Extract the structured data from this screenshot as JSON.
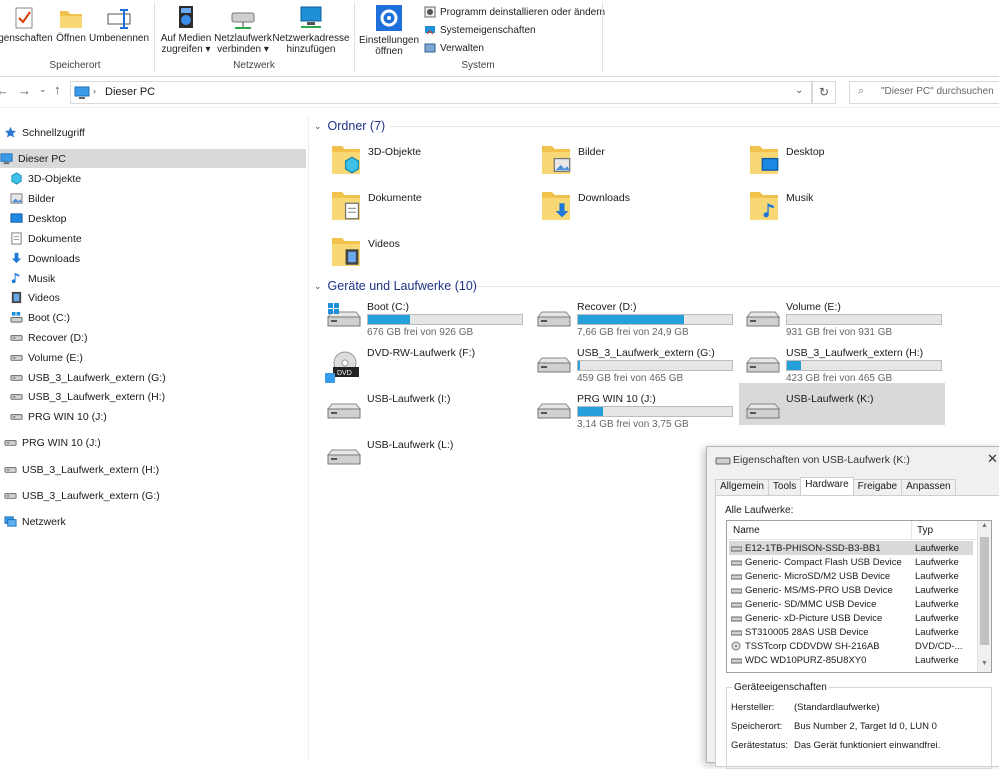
{
  "ribbon": {
    "buttons": [
      {
        "label": "igenschaften"
      },
      {
        "label": "Öffnen"
      },
      {
        "label": "Umbenennen"
      },
      {
        "label1": "Auf Medien",
        "label2": "zugreifen ▾"
      },
      {
        "label1": "Netzlaufwerk",
        "label2": "verbinden ▾"
      },
      {
        "label1": "Netzwerkadresse",
        "label2": "hinzufügen"
      },
      {
        "label1": "Einstellungen",
        "label2": "öffnen"
      }
    ],
    "small_items": [
      "Programm deinstallieren oder ändern",
      "Systemeigenschaften",
      "Verwalten"
    ],
    "groups": [
      "Speicherort",
      "Netzwerk",
      "System"
    ]
  },
  "nav": {
    "path": "Dieser PC",
    "search_placeholder": "\"Dieser PC\" durchsuchen"
  },
  "sidebar": {
    "items": [
      {
        "label": "Schnellzugriff",
        "icon": "star-icon"
      },
      {
        "label": "Dieser PC",
        "icon": "pc-icon"
      },
      {
        "label": "3D-Objekte",
        "icon": "cube-icon"
      },
      {
        "label": "Bilder",
        "icon": "pictures-icon"
      },
      {
        "label": "Desktop",
        "icon": "desktop-icon"
      },
      {
        "label": "Dokumente",
        "icon": "document-icon"
      },
      {
        "label": "Downloads",
        "icon": "download-icon"
      },
      {
        "label": "Musik",
        "icon": "music-icon"
      },
      {
        "label": "Videos",
        "icon": "video-icon"
      },
      {
        "label": "Boot (C:)",
        "icon": "windows-drive-icon"
      },
      {
        "label": "Recover (D:)",
        "icon": "drive-icon"
      },
      {
        "label": "Volume (E:)",
        "icon": "drive-icon"
      },
      {
        "label": "USB_3_Laufwerk_extern (G:)",
        "icon": "drive-icon"
      },
      {
        "label": "USB_3_Laufwerk_extern  (H:)",
        "icon": "drive-icon"
      },
      {
        "label": "PRG WIN 10 (J:)",
        "icon": "drive-icon"
      },
      {
        "label": "PRG WIN 10 (J:)",
        "icon": "drive-icon"
      },
      {
        "label": "USB_3_Laufwerk_extern  (H:)",
        "icon": "drive-icon"
      },
      {
        "label": "USB_3_Laufwerk_extern (G:)",
        "icon": "drive-icon"
      },
      {
        "label": "Netzwerk",
        "icon": "network-icon"
      }
    ]
  },
  "main": {
    "folders_header": "Ordner (7)",
    "folders": [
      "3D-Objekte",
      "Bilder",
      "Desktop",
      "Dokumente",
      "Downloads",
      "Musik",
      "Videos"
    ],
    "drives_header": "Geräte und Laufwerke (10)",
    "drives": [
      {
        "name": "Boot (C:)",
        "free": "676 GB frei von 926 GB",
        "used": 0.27
      },
      {
        "name": "Recover (D:)",
        "free": "7,66 GB frei von 24,9 GB",
        "used": 0.69
      },
      {
        "name": "Volume (E:)",
        "free": "931 GB frei von 931 GB",
        "used": 0.0
      },
      {
        "name": "DVD-RW-Laufwerk (F:)"
      },
      {
        "name": "USB_3_Laufwerk_extern (G:)",
        "free": "459 GB frei von 465 GB",
        "used": 0.013
      },
      {
        "name": "USB_3_Laufwerk_extern  (H:)",
        "free": "423 GB frei von 465 GB",
        "used": 0.09
      },
      {
        "name": "USB-Laufwerk (I:)"
      },
      {
        "name": "PRG WIN 10 (J:)",
        "free": "3,14 GB frei von 3,75 GB",
        "used": 0.16
      },
      {
        "name": "USB-Laufwerk (K:)"
      },
      {
        "name": "USB-Laufwerk (L:)"
      }
    ]
  },
  "dialog": {
    "title": "Eigenschaften von USB-Laufwerk (K:)",
    "tabs": [
      "Allgemein",
      "Tools",
      "Hardware",
      "Freigabe",
      "Anpassen"
    ],
    "all_drives_label": "Alle Laufwerke:",
    "columns": [
      "Name",
      "Typ"
    ],
    "rows": [
      {
        "name": "E12-1TB-PHISON-SSD-B3-BB1",
        "type": "Laufwerke"
      },
      {
        "name": "Generic- Compact Flash USB Device",
        "type": "Laufwerke"
      },
      {
        "name": "Generic- MicroSD/M2 USB Device",
        "type": "Laufwerke"
      },
      {
        "name": "Generic- MS/MS-PRO USB Device",
        "type": "Laufwerke"
      },
      {
        "name": "Generic- SD/MMC USB Device",
        "type": "Laufwerke"
      },
      {
        "name": "Generic- xD-Picture USB Device",
        "type": "Laufwerke"
      },
      {
        "name": "ST310005 28AS USB Device",
        "type": "Laufwerke"
      },
      {
        "name": "TSSTcorp CDDVDW SH-216AB",
        "type": "DVD/CD-..."
      },
      {
        "name": "WDC WD10PURZ-85U8XY0",
        "type": "Laufwerke"
      }
    ],
    "device_props_label": "Geräteeigenschaften",
    "props": [
      {
        "key": "Hersteller:",
        "value": "(Standardlaufwerke)"
      },
      {
        "key": "Speicherort:",
        "value": "Bus Number 2, Target Id 0, LUN 0"
      },
      {
        "key": "Gerätestatus:",
        "value": "Das Gerät funktioniert einwandfrei."
      }
    ]
  },
  "colors": {
    "accent": "#26a0da",
    "selection": "#d9d9d9",
    "header": "#1e3287"
  }
}
